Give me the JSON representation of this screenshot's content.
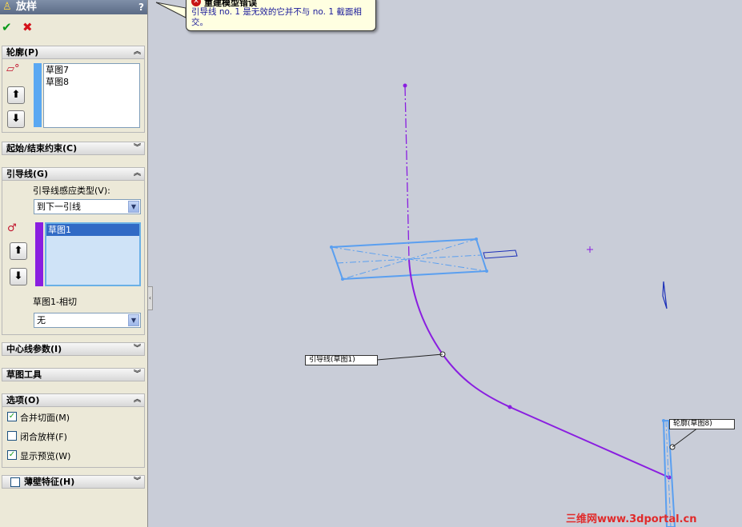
{
  "property_manager": {
    "title": "放样",
    "help": "?",
    "ok_icon": "checkmark-icon",
    "cancel_icon": "x-icon",
    "profiles": {
      "header": "轮廓(P)",
      "items": [
        "草图7",
        "草图8"
      ]
    },
    "start_end": {
      "header": "起始/结束约束(C)"
    },
    "guides": {
      "header": "引导线(G)",
      "influence_label": "引导线感应类型(V):",
      "influence_value": "到下一引线",
      "items": [
        "草图1"
      ],
      "tangency_label": "草图1-相切",
      "tangency_value": "无"
    },
    "centerline": {
      "header": "中心线参数(I)"
    },
    "sketch_tools": {
      "header": "草图工具"
    },
    "options": {
      "header": "选项(O)",
      "merge_tangent": {
        "label": "合并切面(M)",
        "checked": true
      },
      "close_loft": {
        "label": "闭合放样(F)",
        "checked": false
      },
      "show_preview": {
        "label": "显示预览(W)",
        "checked": true
      }
    },
    "thin_feature": {
      "header": "薄壁特征(H)",
      "checked": false
    }
  },
  "error_tooltip": {
    "title": "重建模型错误",
    "message": "引导线 no. 1 是无效的它并不与 no. 1 截面相交。"
  },
  "graphics": {
    "callout_guide": "引导线(草图1)",
    "callout_profile": "轮廓(草图8)"
  },
  "watermark": "三维网www.3dportal.cn",
  "colors": {
    "guide_curve": "#8a1ee0",
    "profile": "#5a9ff0",
    "background": "#c9cdd8"
  }
}
